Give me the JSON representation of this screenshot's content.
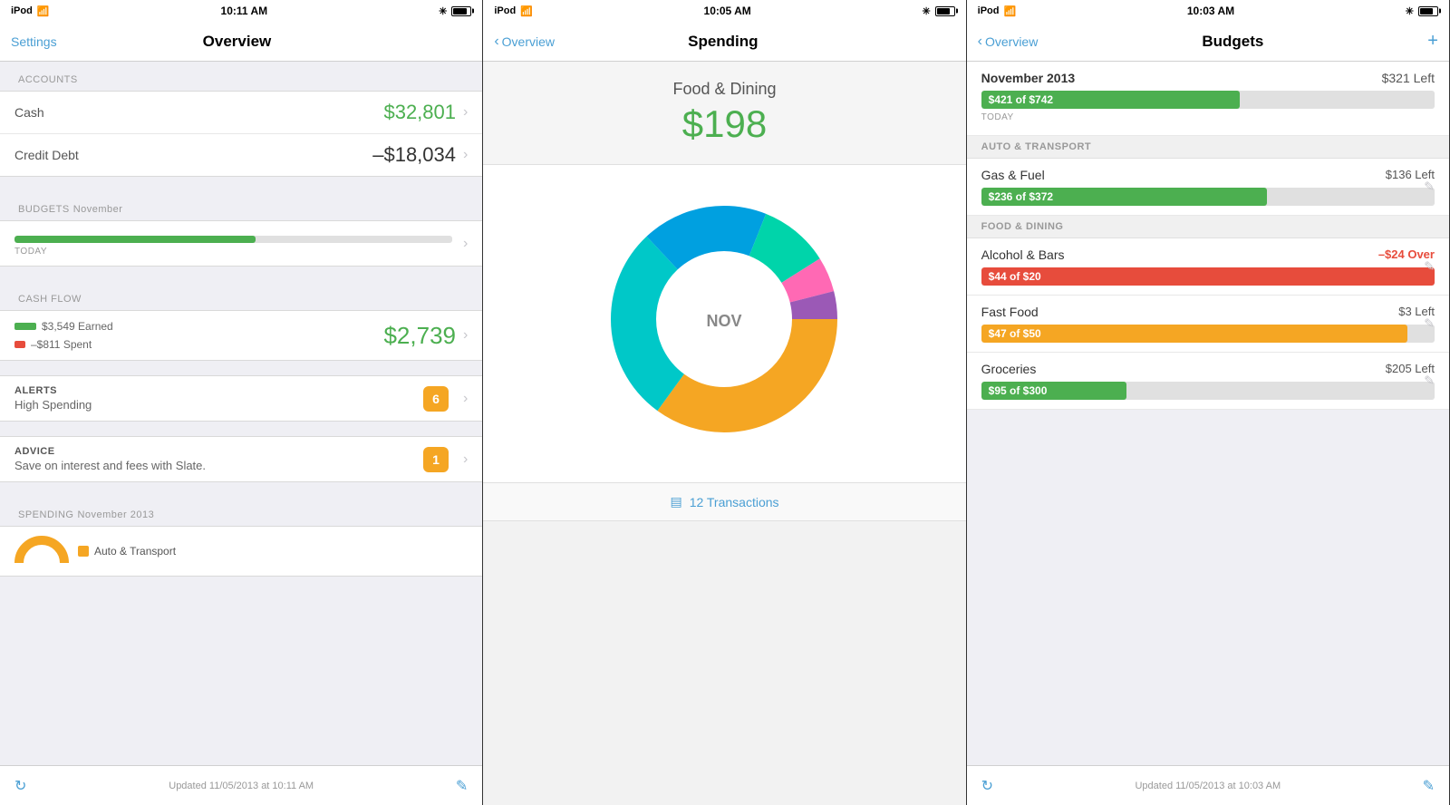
{
  "panel1": {
    "status": {
      "carrier": "iPod",
      "time": "10:11 AM",
      "wifi": "wifi",
      "bluetooth": "BT"
    },
    "nav": {
      "left": "Settings",
      "title": "Overview",
      "right": ""
    },
    "accounts": {
      "header": "ACCOUNTS",
      "cash_label": "Cash",
      "cash_value": "$32,801",
      "debt_label": "Credit Debt",
      "debt_value": "–$18,034"
    },
    "budgets": {
      "header": "BUDGETS",
      "month": "November",
      "bar_pct": 55,
      "today_label": "TODAY"
    },
    "cashflow": {
      "header": "CASH FLOW",
      "earned_label": "$3,549 Earned",
      "spent_label": "–$811 Spent",
      "total": "$2,739"
    },
    "alerts": {
      "header": "ALERTS",
      "sub": "High Spending",
      "badge": "6"
    },
    "advice": {
      "header": "ADVICE",
      "sub": "Save on interest and fees with Slate.",
      "badge": "1"
    },
    "spending": {
      "header": "SPENDING",
      "month": "November 2013",
      "legend": "Auto & Transport"
    },
    "footer": {
      "text": "Updated 11/05/2013 at 10:11 AM"
    }
  },
  "panel2": {
    "status": {
      "carrier": "iPod",
      "time": "10:05 AM"
    },
    "nav": {
      "left": "Overview",
      "title": "Spending"
    },
    "category": "Food & Dining",
    "amount": "$198",
    "donut": {
      "center_label": "NOV",
      "segments": [
        {
          "color": "#f5a623",
          "pct": 35,
          "label": "Orange"
        },
        {
          "color": "#00c8c8",
          "pct": 28,
          "label": "Cyan"
        },
        {
          "color": "#00a0e0",
          "pct": 18,
          "label": "Blue"
        },
        {
          "color": "#00d4aa",
          "pct": 10,
          "label": "Teal"
        },
        {
          "color": "#ff69b4",
          "pct": 5,
          "label": "Pink"
        },
        {
          "color": "#9b59b6",
          "pct": 4,
          "label": "Purple"
        }
      ]
    },
    "transactions": {
      "icon": "list",
      "label": "12 Transactions"
    }
  },
  "panel3": {
    "status": {
      "carrier": "iPod",
      "time": "10:03 AM"
    },
    "nav": {
      "left": "Overview",
      "title": "Budgets",
      "right": "+"
    },
    "november": {
      "name": "November 2013",
      "left": "$321 Left",
      "spent": "$421 of $742",
      "bar_pct": 57,
      "bar_color": "#4caf50",
      "today_label": "TODAY"
    },
    "cat1": "AUTO & TRANSPORT",
    "gas": {
      "name": "Gas & Fuel",
      "left": "$136 Left",
      "spent": "$236 of $372",
      "bar_pct": 63,
      "bar_color": "#4caf50"
    },
    "cat2": "FOOD & DINING",
    "alcohol": {
      "name": "Alcohol & Bars",
      "left": "–$24 Over",
      "spent": "$44 of $20",
      "bar_pct": 100,
      "bar_color": "#e74c3c",
      "over": true
    },
    "fastfood": {
      "name": "Fast Food",
      "left": "$3 Left",
      "spent": "$47 of $50",
      "bar_pct": 94,
      "bar_color": "#f5a623"
    },
    "groceries": {
      "name": "Groceries",
      "left": "$205 Left",
      "spent": "$95 of $300",
      "bar_pct": 32,
      "bar_color": "#4caf50"
    },
    "footer": {
      "text": "Updated 11/05/2013 at 10:03 AM"
    }
  }
}
